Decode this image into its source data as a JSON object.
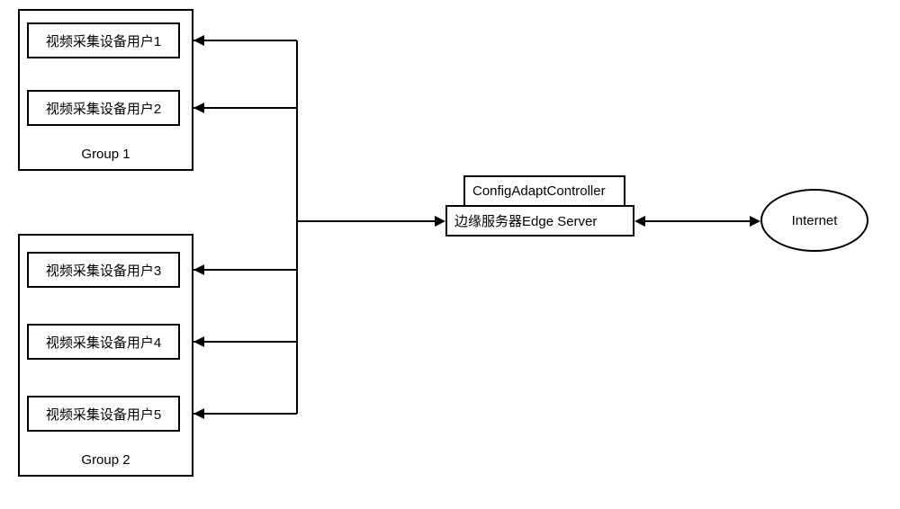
{
  "groups": [
    {
      "label": "Group 1",
      "users": [
        "视频采集设备用户1",
        "视频采集设备用户2"
      ]
    },
    {
      "label": "Group 2",
      "users": [
        "视频采集设备用户3",
        "视频采集设备用户4",
        "视频采集设备用户5"
      ]
    }
  ],
  "server": {
    "controller_label": "ConfigAdaptController",
    "edge_label": "边缘服务器Edge Server"
  },
  "internet": {
    "label": "Internet"
  }
}
